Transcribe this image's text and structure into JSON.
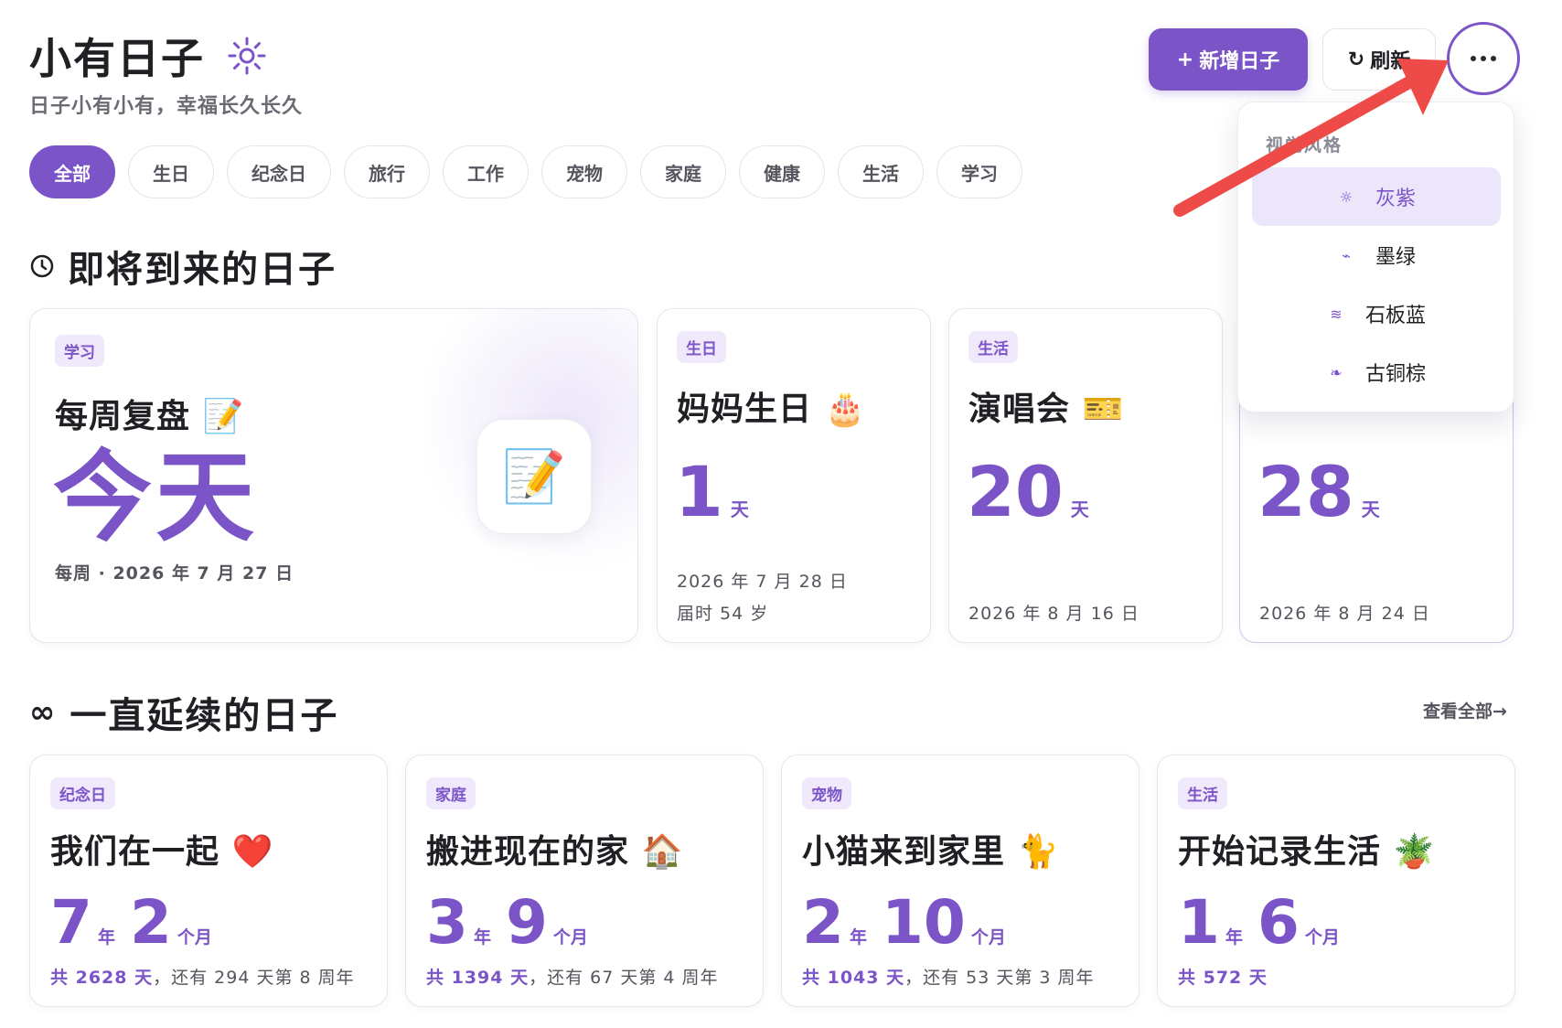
{
  "header": {
    "title": "小有日子",
    "subtitle": "日子小有小有，幸福长久长久",
    "add_button": "新增日子",
    "refresh_button": "刷新"
  },
  "filters": [
    "全部",
    "生日",
    "纪念日",
    "旅行",
    "工作",
    "宠物",
    "家庭",
    "健康",
    "生活",
    "学习"
  ],
  "sections": {
    "upcoming": "即将到来的日子",
    "lasting": "一直延续的日子",
    "view_all": "查看全部→"
  },
  "hero": {
    "tag": "学习",
    "title": "每周复盘 📝",
    "big": "今天",
    "date": "每周 · 2026 年 7 月 27 日",
    "emoji": "📝"
  },
  "upcoming": [
    {
      "tag": "生日",
      "title": "妈妈生日 🎂",
      "days": "1",
      "unit": "天",
      "date": "2026 年 7 月 28 日",
      "sub": "届时 54 岁"
    },
    {
      "tag": "生活",
      "title": "演唱会 🎫",
      "days": "20",
      "unit": "天",
      "date": "2026 年 8 月 16 日"
    },
    {
      "tag": "",
      "title": "",
      "days": "28",
      "unit": "天",
      "date": "2026 年 8 月 24 日"
    }
  ],
  "lasting": [
    {
      "tag": "纪念日",
      "title": "我们在一起 ❤️",
      "years": "7",
      "years_unit": "年",
      "months": "2",
      "months_unit": "个月",
      "total": "共 2628 天",
      "rest": "，还有 294 天第 8 周年"
    },
    {
      "tag": "家庭",
      "title": "搬进现在的家 🏠",
      "years": "3",
      "years_unit": "年",
      "months": "9",
      "months_unit": "个月",
      "total": "共 1394 天",
      "rest": "，还有 67 天第 4 周年"
    },
    {
      "tag": "宠物",
      "title": "小猫来到家里 🐈",
      "years": "2",
      "years_unit": "年",
      "months": "10",
      "months_unit": "个月",
      "total": "共 1043 天",
      "rest": "，还有 53 天第 3 周年"
    },
    {
      "tag": "生活",
      "title": "开始记录生活 🪴",
      "years": "1",
      "years_unit": "年",
      "months": "6",
      "months_unit": "个月",
      "total": "共 572 天",
      "rest": ""
    }
  ],
  "dropdown": {
    "label": "视觉风格",
    "items": [
      {
        "icon": "☼",
        "label": "灰紫",
        "selected": true
      },
      {
        "icon": "⌁",
        "label": "墨绿"
      },
      {
        "icon": "≋",
        "label": "石板蓝"
      },
      {
        "icon": "❧",
        "label": "古铜棕"
      }
    ]
  },
  "colors": {
    "accent": "#7b55c8",
    "accent_soft": "#efe9fb",
    "annotation_arrow": "#ee4b48"
  }
}
